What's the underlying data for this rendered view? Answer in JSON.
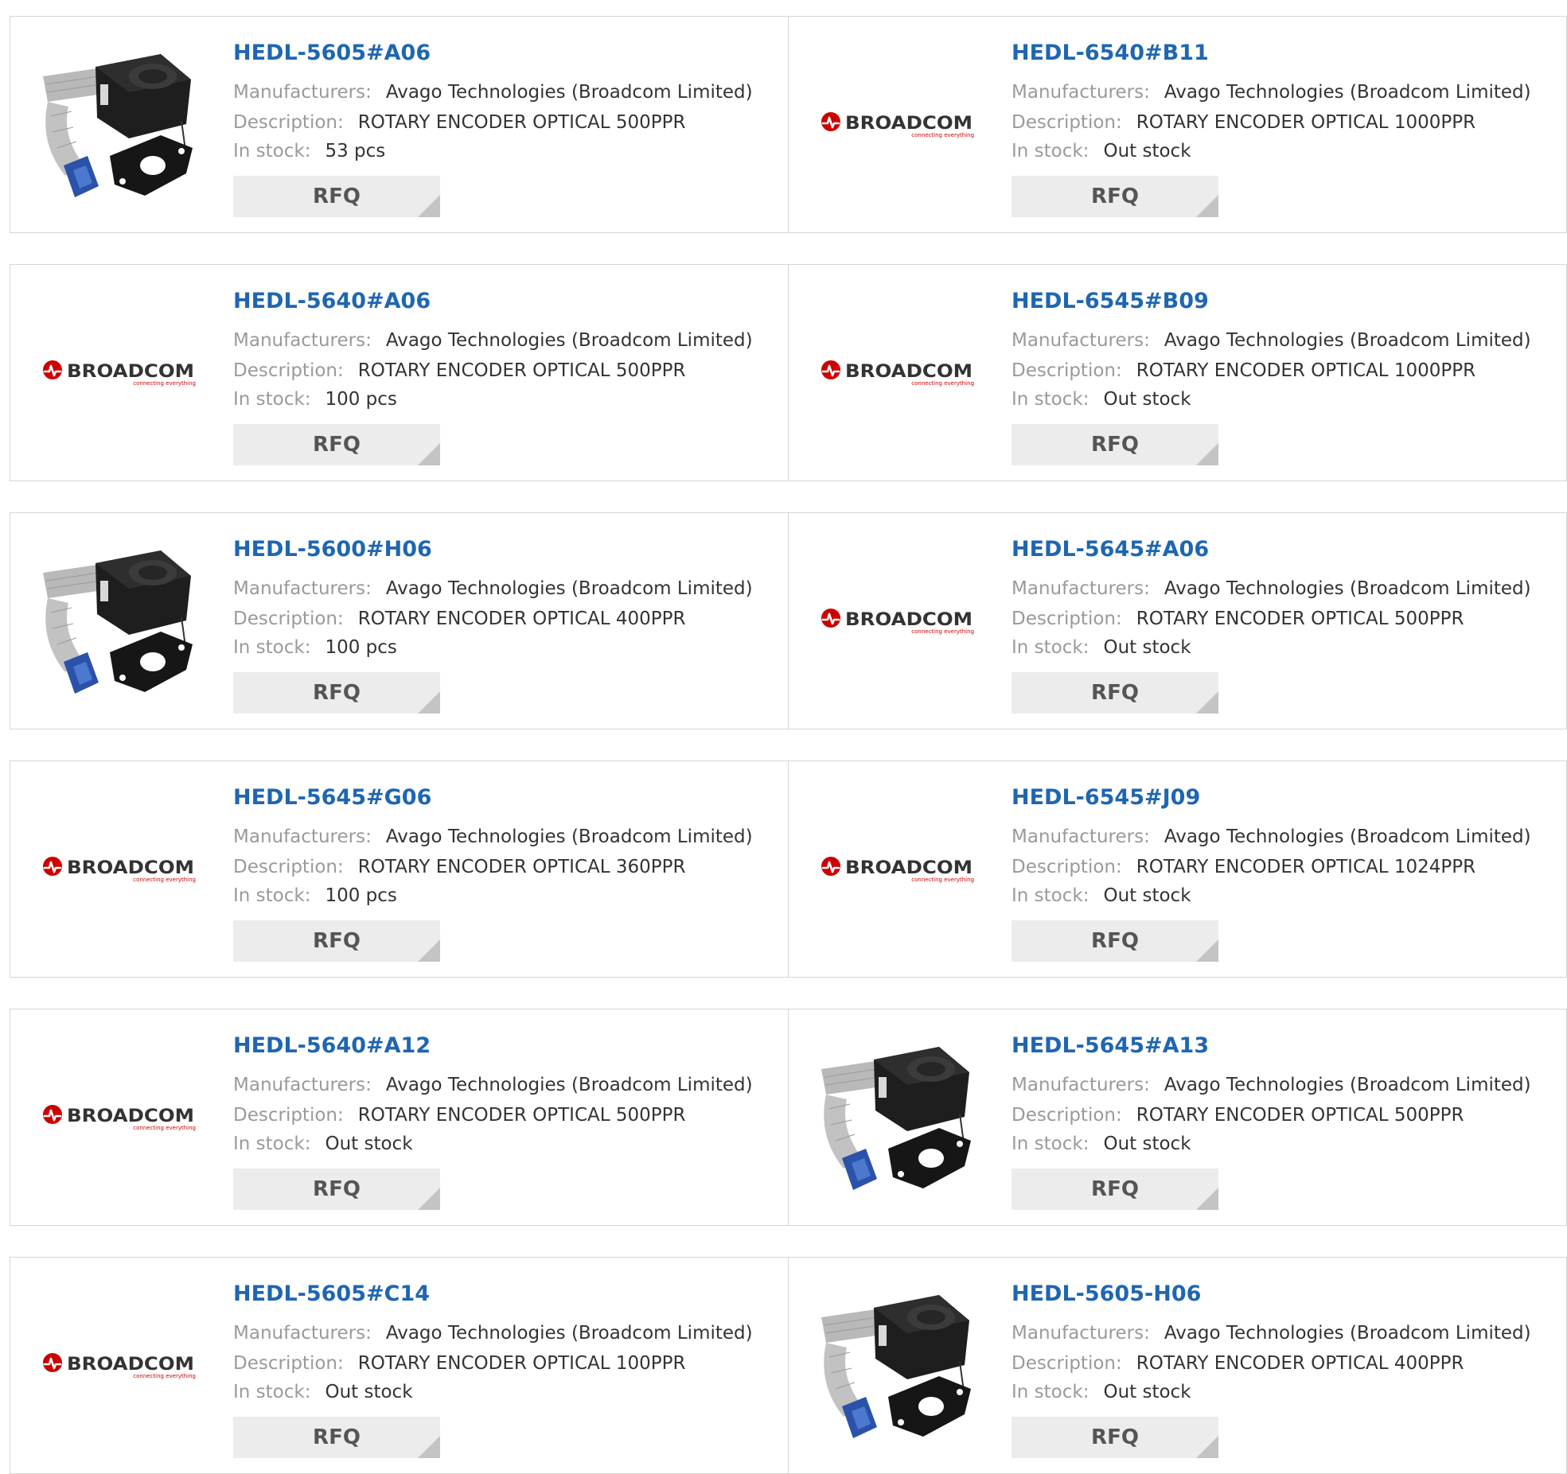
{
  "labels": {
    "manufacturers": "Manufacturers:",
    "description": "Description:",
    "in_stock": "In stock:",
    "rfq": "RFQ"
  },
  "logo": {
    "wordmark": "BROADCOM",
    "tagline": "connecting everything"
  },
  "colors": {
    "part_link": "#1f66b1",
    "logo_red": "#cc0000",
    "logo_text": "#333333"
  },
  "rows": [
    {
      "left": {
        "part_number": "HEDL-5605#A06",
        "manufacturer": "Avago Technologies (Broadcom Limited)",
        "description": "ROTARY ENCODER OPTICAL 500PPR",
        "stock": "53 pcs",
        "image": "encoder-photo"
      },
      "right": {
        "part_number": "HEDL-6540#B11",
        "manufacturer": "Avago Technologies (Broadcom Limited)",
        "description": "ROTARY ENCODER OPTICAL 1000PPR",
        "stock": "Out stock",
        "image": "broadcom-logo"
      }
    },
    {
      "left": {
        "part_number": "HEDL-5640#A06",
        "manufacturer": "Avago Technologies (Broadcom Limited)",
        "description": "ROTARY ENCODER OPTICAL 500PPR",
        "stock": "100 pcs",
        "image": "broadcom-logo"
      },
      "right": {
        "part_number": "HEDL-6545#B09",
        "manufacturer": "Avago Technologies (Broadcom Limited)",
        "description": "ROTARY ENCODER OPTICAL 1000PPR",
        "stock": "Out stock",
        "image": "broadcom-logo"
      }
    },
    {
      "left": {
        "part_number": "HEDL-5600#H06",
        "manufacturer": "Avago Technologies (Broadcom Limited)",
        "description": "ROTARY ENCODER OPTICAL 400PPR",
        "stock": "100 pcs",
        "image": "encoder-photo"
      },
      "right": {
        "part_number": "HEDL-5645#A06",
        "manufacturer": "Avago Technologies (Broadcom Limited)",
        "description": "ROTARY ENCODER OPTICAL 500PPR",
        "stock": "Out stock",
        "image": "broadcom-logo"
      }
    },
    {
      "left": {
        "part_number": "HEDL-5645#G06",
        "manufacturer": "Avago Technologies (Broadcom Limited)",
        "description": "ROTARY ENCODER OPTICAL 360PPR",
        "stock": "100 pcs",
        "image": "broadcom-logo"
      },
      "right": {
        "part_number": "HEDL-6545#J09",
        "manufacturer": "Avago Technologies (Broadcom Limited)",
        "description": "ROTARY ENCODER OPTICAL 1024PPR",
        "stock": "Out stock",
        "image": "broadcom-logo"
      }
    },
    {
      "left": {
        "part_number": "HEDL-5640#A12",
        "manufacturer": "Avago Technologies (Broadcom Limited)",
        "description": "ROTARY ENCODER OPTICAL 500PPR",
        "stock": "Out stock",
        "image": "broadcom-logo"
      },
      "right": {
        "part_number": "HEDL-5645#A13",
        "manufacturer": "Avago Technologies (Broadcom Limited)",
        "description": "ROTARY ENCODER OPTICAL 500PPR",
        "stock": "Out stock",
        "image": "encoder-photo"
      }
    },
    {
      "left": {
        "part_number": "HEDL-5605#C14",
        "manufacturer": "Avago Technologies (Broadcom Limited)",
        "description": "ROTARY ENCODER OPTICAL 100PPR",
        "stock": "Out stock",
        "image": "broadcom-logo"
      },
      "right": {
        "part_number": "HEDL-5605-H06",
        "manufacturer": "Avago Technologies (Broadcom Limited)",
        "description": "ROTARY ENCODER OPTICAL 400PPR",
        "stock": "Out stock",
        "image": "encoder-photo"
      }
    }
  ]
}
